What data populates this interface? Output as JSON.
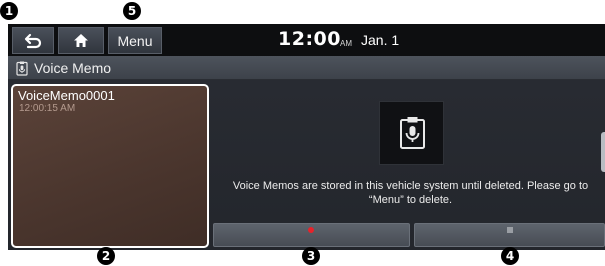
{
  "topbar": {
    "back_icon": "back-arrow-icon",
    "home_icon": "home-icon",
    "menu_label": "Menu",
    "time": "12:00",
    "ampm": "AM",
    "date": "Jan. 1"
  },
  "title_bar": {
    "icon": "voice-memo-icon",
    "title": "Voice Memo"
  },
  "recording": {
    "name": "VoiceMemo0001",
    "time": "12:00:15 AM"
  },
  "main": {
    "mic_icon": "microphone-icon",
    "info_text": "Voice Memos are stored in this vehicle system until deleted. Please go to “Menu” to delete."
  },
  "controls": {
    "record_icon": "record-icon",
    "stop_icon": "stop-icon"
  },
  "callouts": [
    "1",
    "2",
    "3",
    "4",
    "5"
  ],
  "colors": {
    "record_red": "#e8222a",
    "card_brown": "#4b362e",
    "screen_dark": "#25282e"
  }
}
